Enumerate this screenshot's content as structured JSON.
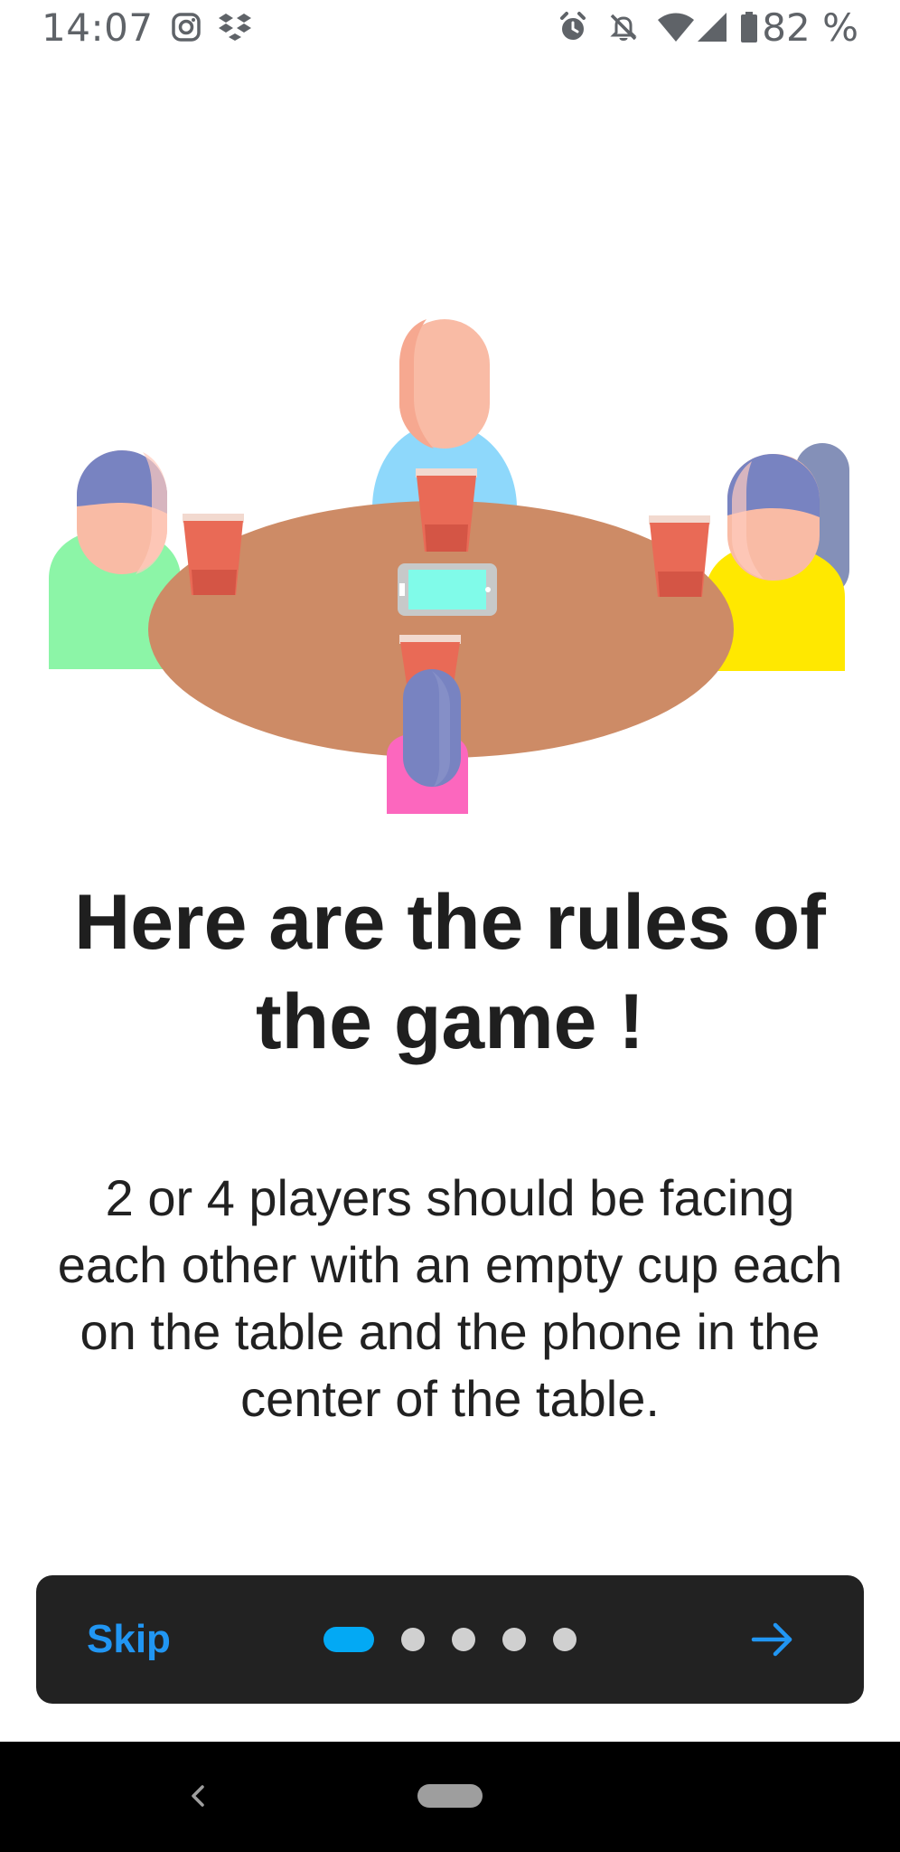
{
  "status_bar": {
    "time": "14:07",
    "battery_percent": "82 %",
    "icons": [
      "instagram-icon",
      "dropbox-icon",
      "alarm-icon",
      "notifications-off-icon",
      "wifi-icon",
      "signal-icon",
      "battery-icon"
    ]
  },
  "onboarding": {
    "title": "Here are the rules of the game !",
    "description": "2 or 4 players should be facing each other with an empty cup each on the table and the phone in the center of the table.",
    "current_page": 1,
    "total_pages": 5
  },
  "nav_panel": {
    "skip_label": "Skip",
    "next_icon": "arrow-right-icon"
  },
  "system_nav": {
    "back_icon": "back-chevron-icon",
    "home_icon": "home-pill"
  },
  "colors": {
    "accent": "#2196f3",
    "active_dot": "#03a9f4",
    "inactive_dot": "#d0d0d0",
    "panel_bg": "#222222",
    "table": "#cd8b66",
    "cup": "#e96a56"
  }
}
